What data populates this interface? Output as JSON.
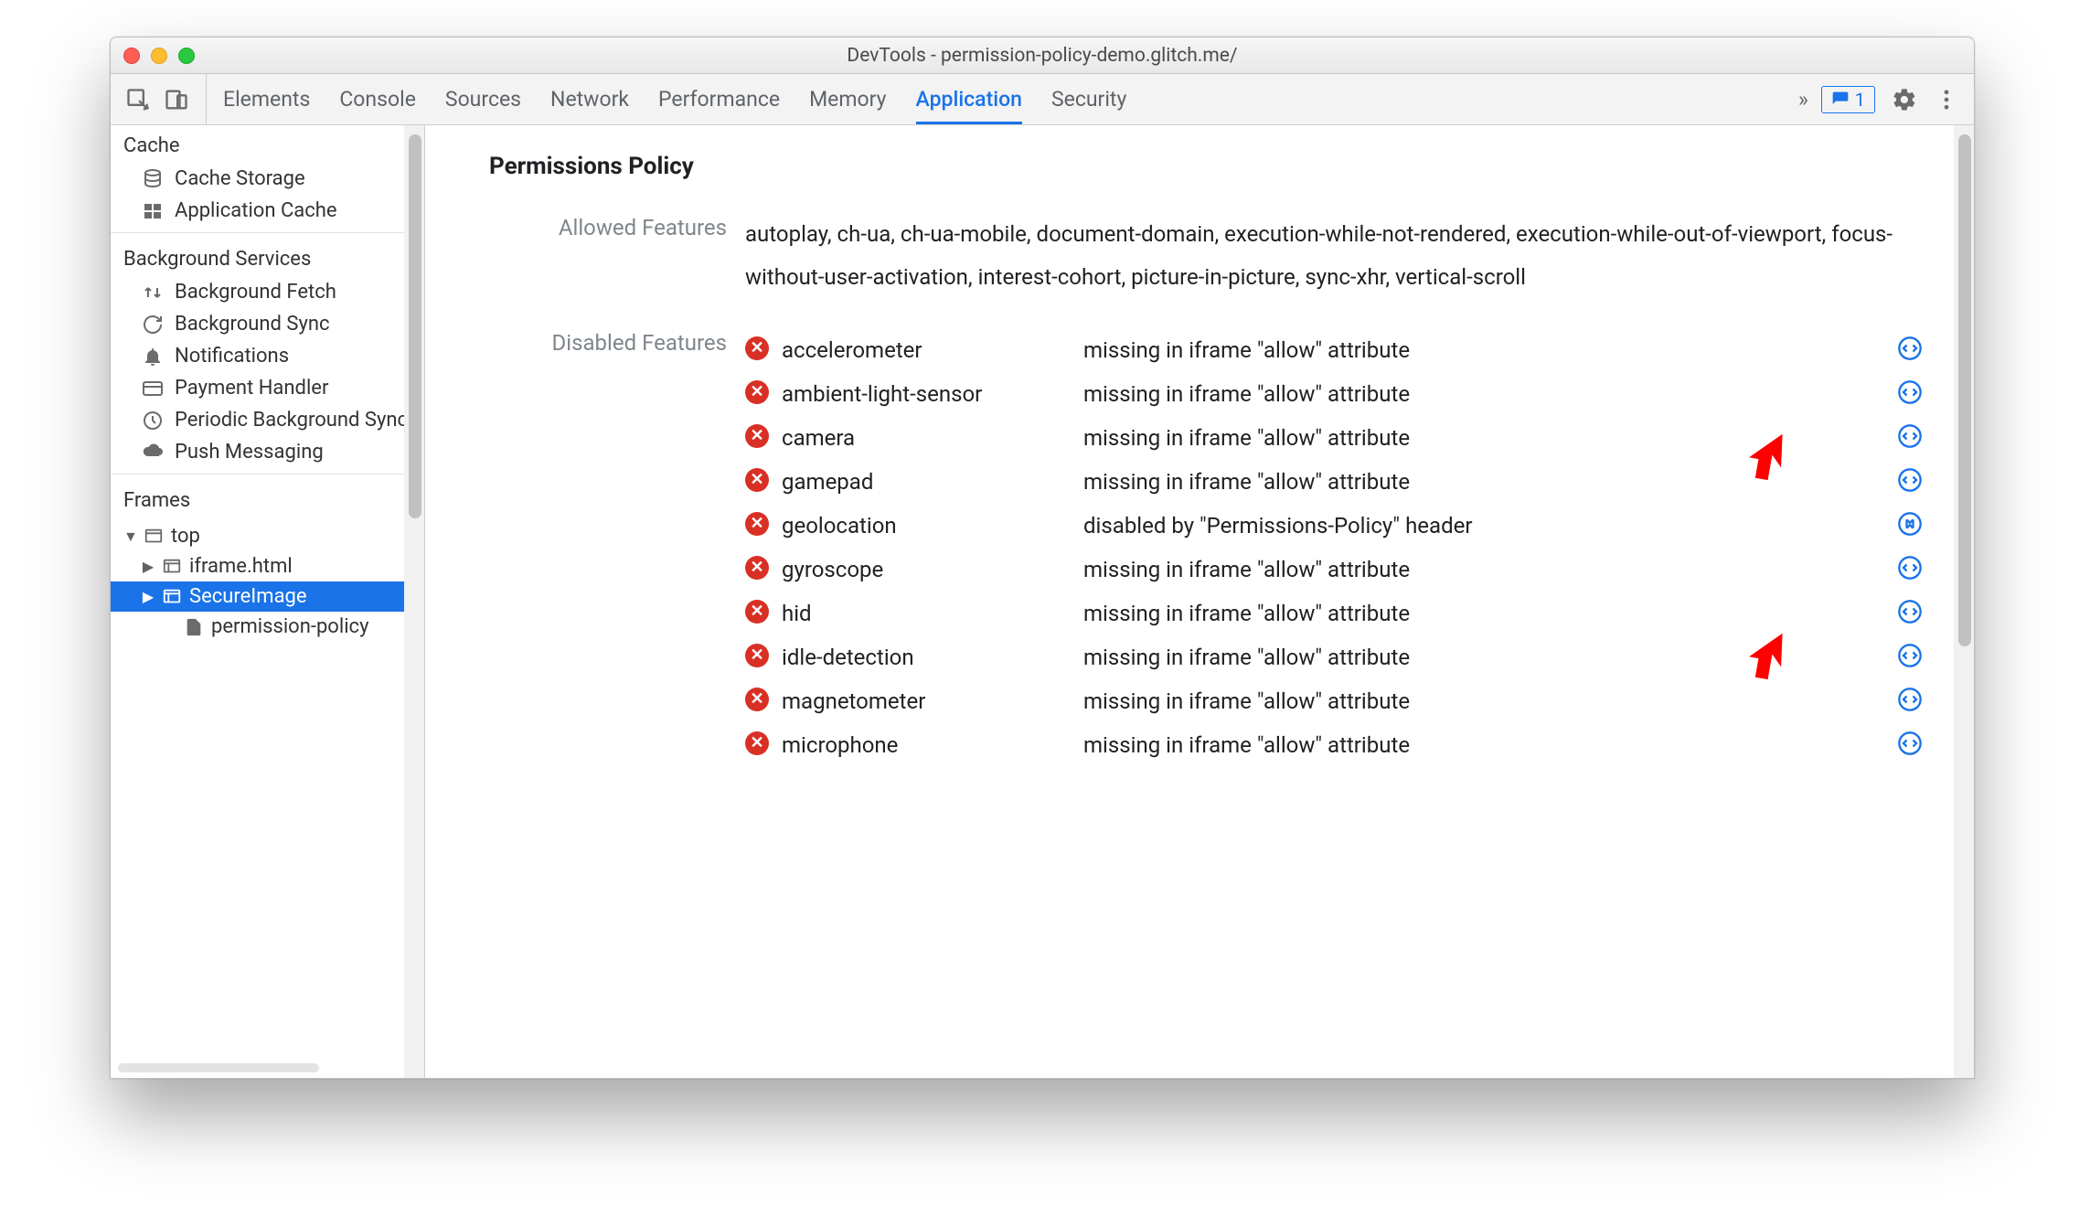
{
  "window": {
    "title": "DevTools - permission-policy-demo.glitch.me/"
  },
  "toolbar": {
    "tabs": [
      "Elements",
      "Console",
      "Sources",
      "Network",
      "Performance",
      "Memory",
      "Application",
      "Security"
    ],
    "active_tab": "Application",
    "overflow_glyph": "»",
    "issues_count": "1"
  },
  "sidebar": {
    "sections": {
      "cache": {
        "title": "Cache",
        "items": [
          "Cache Storage",
          "Application Cache"
        ]
      },
      "background": {
        "title": "Background Services",
        "items": [
          "Background Fetch",
          "Background Sync",
          "Notifications",
          "Payment Handler",
          "Periodic Background Sync",
          "Push Messaging"
        ]
      },
      "frames": {
        "title": "Frames",
        "tree": [
          {
            "label": "top",
            "depth": 0,
            "expanded": true,
            "icon": "window"
          },
          {
            "label": "iframe.html",
            "depth": 1,
            "expanded": false,
            "icon": "frame"
          },
          {
            "label": "SecureImage",
            "depth": 1,
            "expanded": false,
            "icon": "frame",
            "selected": true
          },
          {
            "label": "permission-policy",
            "depth": 2,
            "icon": "document"
          }
        ]
      }
    }
  },
  "main": {
    "heading": "Permissions Policy",
    "allowed_label": "Allowed Features",
    "allowed_value": "autoplay, ch-ua, ch-ua-mobile, document-domain, execution-while-not-rendered, execution-while-out-of-viewport, focus-without-user-activation, interest-cohort, picture-in-picture, sync-xhr, vertical-scroll",
    "disabled_label": "Disabled Features",
    "disabled": [
      {
        "name": "accelerometer",
        "reason": "missing in iframe \"allow\" attribute",
        "link": "code"
      },
      {
        "name": "ambient-light-sensor",
        "reason": "missing in iframe \"allow\" attribute",
        "link": "code"
      },
      {
        "name": "camera",
        "reason": "missing in iframe \"allow\" attribute",
        "link": "code"
      },
      {
        "name": "gamepad",
        "reason": "missing in iframe \"allow\" attribute",
        "link": "code"
      },
      {
        "name": "geolocation",
        "reason": "disabled by \"Permissions-Policy\" header",
        "link": "network"
      },
      {
        "name": "gyroscope",
        "reason": "missing in iframe \"allow\" attribute",
        "link": "code"
      },
      {
        "name": "hid",
        "reason": "missing in iframe \"allow\" attribute",
        "link": "code"
      },
      {
        "name": "idle-detection",
        "reason": "missing in iframe \"allow\" attribute",
        "link": "code"
      },
      {
        "name": "magnetometer",
        "reason": "missing in iframe \"allow\" attribute",
        "link": "code"
      },
      {
        "name": "microphone",
        "reason": "missing in iframe \"allow\" attribute",
        "link": "code"
      }
    ]
  }
}
